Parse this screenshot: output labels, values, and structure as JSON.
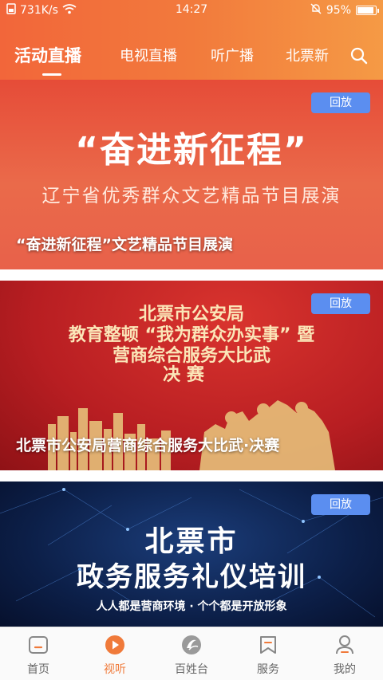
{
  "status_bar": {
    "speed": "731K/s",
    "time": "14:27",
    "battery": "95%",
    "battery_level": 0.95
  },
  "tabs": [
    {
      "label": "活动直播",
      "active": true
    },
    {
      "label": "电视直播",
      "active": false
    },
    {
      "label": "听广播",
      "active": false
    },
    {
      "label": "北票新",
      "active": false
    }
  ],
  "cards": [
    {
      "headline": "“奋进新征程”",
      "subheadline": "辽宁省优秀群众文艺精品节目展演",
      "badge": "回放",
      "title": "“奋进新征程”文艺精品节目展演"
    },
    {
      "poster_lines": [
        "北票市公安局",
        "教育整顿 “我为群众办实事” 暨",
        "营商综合服务大比武",
        "决    赛"
      ],
      "badge": "回放",
      "title": "北票市公安局营商综合服务大比武·决赛"
    },
    {
      "poster_line1": "北票市",
      "poster_line2": "政务服务礼仪培训",
      "poster_line3": "人人都是营商环境 · 个个都是开放形象",
      "badge": "回放"
    }
  ],
  "bottom_nav": [
    {
      "label": "首页",
      "icon": "home-icon",
      "active": false
    },
    {
      "label": "视听",
      "icon": "play-icon",
      "active": true
    },
    {
      "label": "百姓台",
      "icon": "logo-icon",
      "active": false
    },
    {
      "label": "服务",
      "icon": "bookmark-icon",
      "active": false
    },
    {
      "label": "我的",
      "icon": "user-icon",
      "active": false
    }
  ],
  "colors": {
    "accent": "#f07a3a",
    "header_start": "#f2663a",
    "header_end": "#f59a45",
    "badge": "#5b8ef0"
  }
}
